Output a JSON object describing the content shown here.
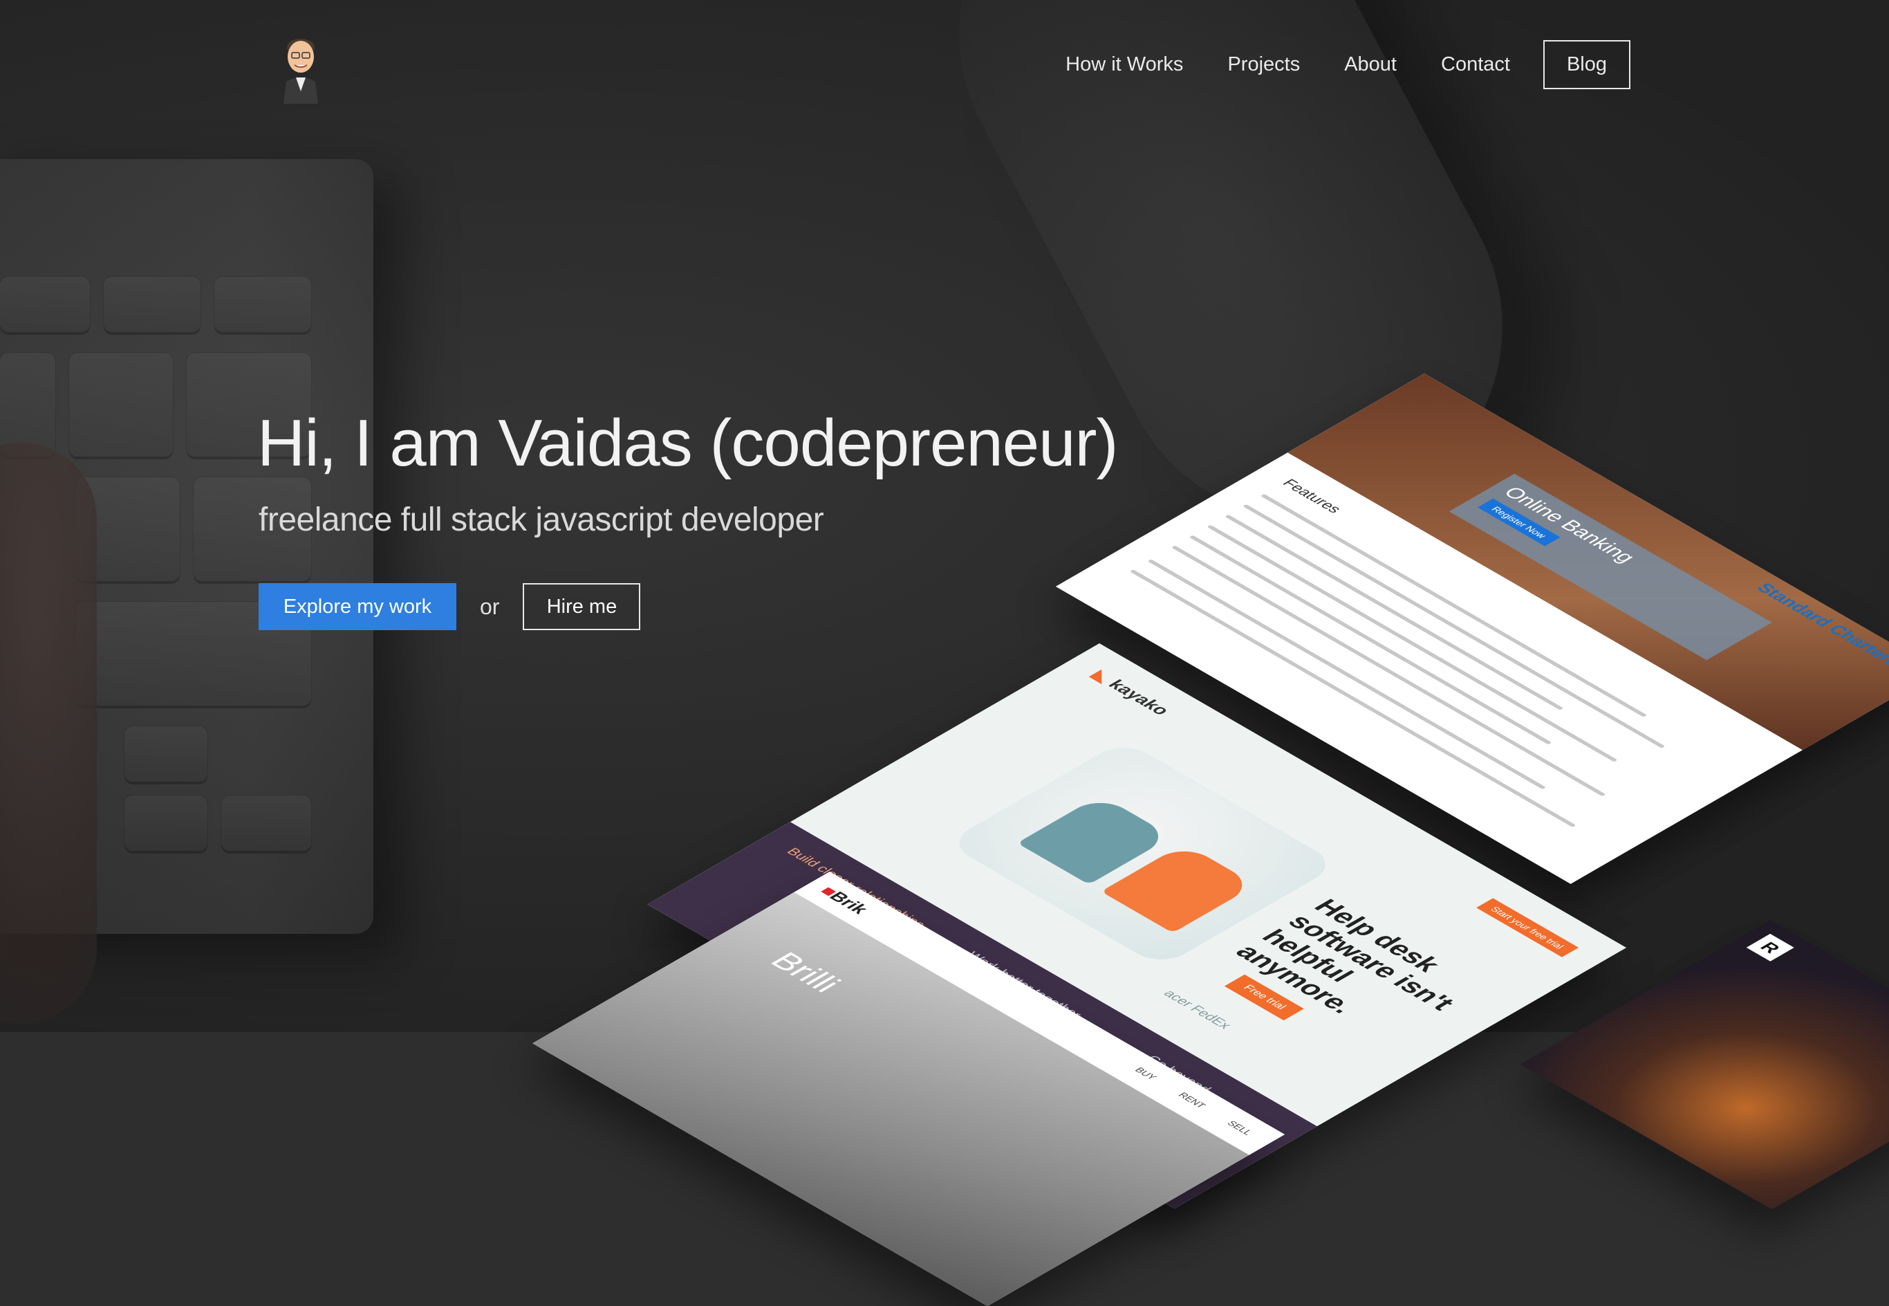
{
  "header": {
    "avatar_alt": "Vaidas avatar",
    "nav": [
      {
        "label": "How it Works"
      },
      {
        "label": "Projects"
      },
      {
        "label": "About"
      },
      {
        "label": "Contact"
      }
    ],
    "blog_label": "Blog"
  },
  "hero": {
    "title": "Hi, I am Vaidas (codepreneur)",
    "subtitle": "freelance full stack javascript developer",
    "primary_cta": "Explore my work",
    "or_text": "or",
    "secondary_cta": "Hire me"
  },
  "projects": {
    "standard_chartered": {
      "logo": "Standard Chartered",
      "panel_title": "Online Banking",
      "panel_button": "Register Now",
      "features": "Features"
    },
    "kayako": {
      "logo": "kayako",
      "headline": "Help desk software isn't helpful anymore.",
      "cta": "Free trial",
      "trial": "Start your free trial",
      "strip1": "Build closer relationships",
      "strip2": "Work better together",
      "strip3": "Go beyond",
      "brands": "acer   FedEx"
    },
    "brik": {
      "logo": "Brik",
      "hero": "Brilli",
      "nav": "BUY RENT SELL"
    },
    "rx": {
      "logo": "R"
    }
  },
  "colors": {
    "accent": "#2e7fdf",
    "background": "#2e2e2e",
    "kayako_orange": "#f26c2b"
  },
  "icons": {
    "avatar": "cartoon-avatar-icon"
  }
}
